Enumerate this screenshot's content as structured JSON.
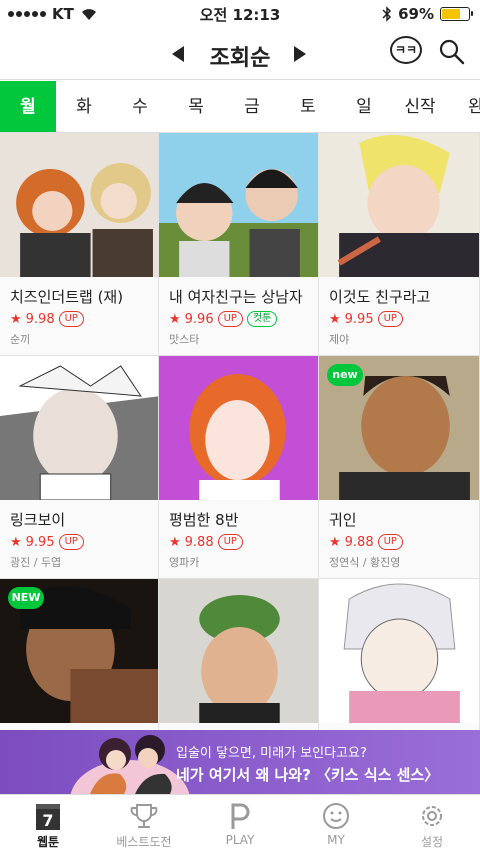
{
  "status": {
    "carrier": "KT",
    "time": "오전 12:13",
    "battery": "69%",
    "battery_level": 0.69
  },
  "header": {
    "title": "조회순",
    "chat_label": "ㅋㅋ"
  },
  "tabs": [
    {
      "label": "월",
      "active": true
    },
    {
      "label": "화"
    },
    {
      "label": "수"
    },
    {
      "label": "목"
    },
    {
      "label": "금"
    },
    {
      "label": "토"
    },
    {
      "label": "일"
    },
    {
      "label": "신작"
    },
    {
      "label": "완"
    }
  ],
  "comics": [
    {
      "title": "치즈인더트랩 (재)",
      "rating": "9.98",
      "up": "UP",
      "extra": "",
      "author": "순끼",
      "new": ""
    },
    {
      "title": "내 여자친구는 상남자",
      "rating": "9.96",
      "up": "UP",
      "extra": "컷툰",
      "author": "맛스타",
      "new": ""
    },
    {
      "title": "이것도 친구라고",
      "rating": "9.95",
      "up": "UP",
      "extra": "",
      "author": "제야",
      "new": ""
    },
    {
      "title": "링크보이",
      "rating": "9.95",
      "up": "UP",
      "extra": "",
      "author": "광진 / 두엽",
      "new": ""
    },
    {
      "title": "평범한 8반",
      "rating": "9.88",
      "up": "UP",
      "extra": "",
      "author": "영파카",
      "new": ""
    },
    {
      "title": "귀인",
      "rating": "9.88",
      "up": "UP",
      "extra": "",
      "author": "정연식 / 황진영",
      "new": "new"
    },
    {
      "title": "",
      "rating": "",
      "up": "",
      "extra": "",
      "author": "",
      "new": "NEW"
    },
    {
      "title": "",
      "rating": "",
      "up": "",
      "extra": "",
      "author": "",
      "new": ""
    },
    {
      "title": "",
      "rating": "",
      "up": "",
      "extra": "",
      "author": "",
      "new": ""
    }
  ],
  "banner": {
    "line1": "입술이 닿으면, 미래가 보인다고요?",
    "line2": "네가 여기서 왜 나와? 〈키스 식스 센스〉"
  },
  "nav": {
    "items": [
      {
        "label": "웹툰",
        "icon": "calendar-7-icon",
        "day": "7",
        "active": true
      },
      {
        "label": "베스트도전",
        "icon": "trophy-icon"
      },
      {
        "label": "PLAY",
        "icon": "play-p-icon"
      },
      {
        "label": "MY",
        "icon": "smiley-icon"
      },
      {
        "label": "설정",
        "icon": "gear-icon"
      }
    ]
  },
  "colors": {
    "accent": "#00c73c",
    "rating": "#e8352b",
    "banner": "#8a5dcc"
  }
}
